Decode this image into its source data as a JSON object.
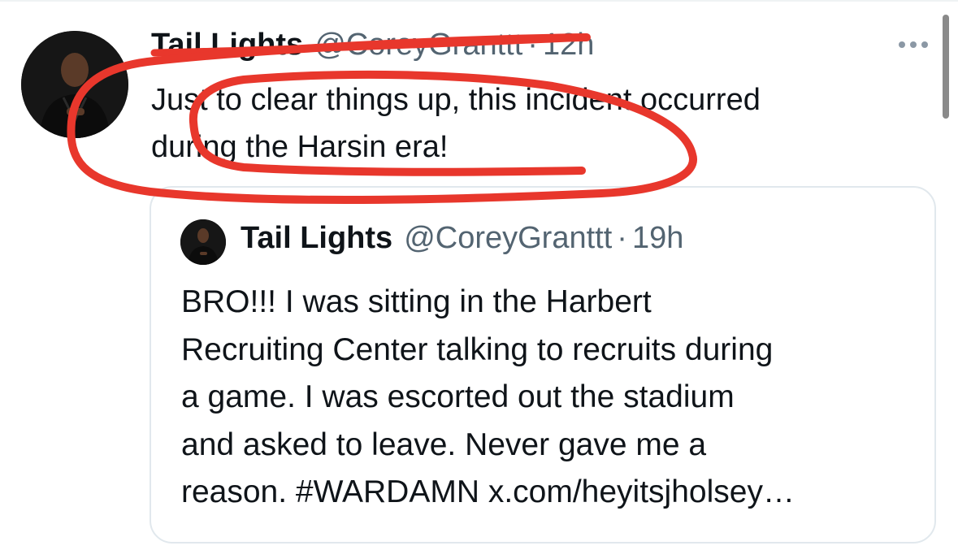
{
  "tweet": {
    "author_name": "Tail Lights",
    "author_handle": "@CoreyGranttt",
    "separator": "·",
    "time_ago": "12h",
    "text": "Just to clear things up, this incident occurred\nduring the Harsin era!",
    "avatar_icon": "profile-photo",
    "more_icon": "more-dots-icon"
  },
  "quoted_tweet": {
    "author_name": "Tail Lights",
    "author_handle": "@CoreyGranttt",
    "separator": "·",
    "time_ago": "19h",
    "text": "BRO!!! I was sitting in the Harbert\nRecruiting Center talking to recruits during\na game. I was escorted out the stadium\nand asked to leave. Never gave me a\nreason. #WARDAMN x.com/heyitsjholsey…"
  },
  "colors": {
    "text_primary": "#0f1419",
    "text_secondary": "#536471",
    "card_border": "#e1e8ed",
    "annotation_red": "#e8372c"
  }
}
